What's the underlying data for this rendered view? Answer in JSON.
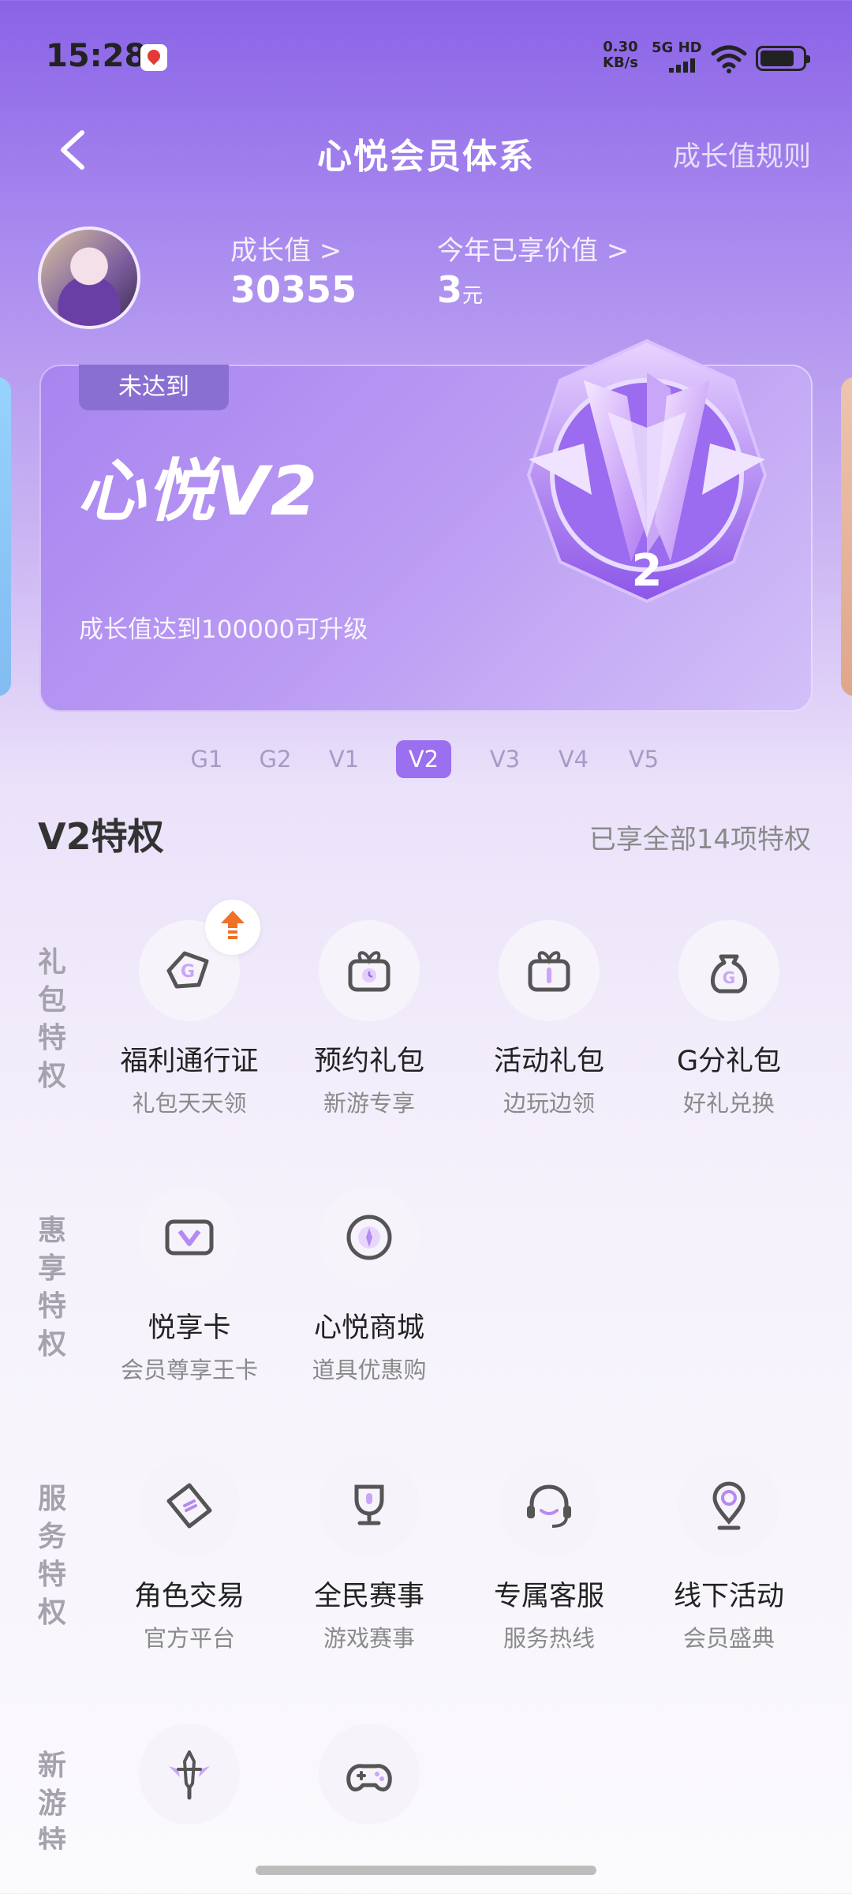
{
  "status": {
    "time": "15:28",
    "net_speed_value": "0.30",
    "net_speed_unit": "KB/s",
    "network": "5G HD"
  },
  "nav": {
    "title": "心悦会员体系",
    "rules_link": "成长值规则"
  },
  "profile": {
    "growth_label": "成长值 >",
    "growth_value": "30355",
    "enjoy_label": "今年已享价值 >",
    "enjoy_value": "3",
    "enjoy_unit": "元"
  },
  "level_card": {
    "status": "未达到",
    "level_name": "心悦V2",
    "upgrade_tip": "成长值达到100000可升级",
    "medal_number": "2"
  },
  "levels": {
    "tabs": [
      "G1",
      "G2",
      "V1",
      "V2",
      "V3",
      "V4",
      "V5"
    ],
    "active": "V2"
  },
  "privileges": {
    "title": "V2特权",
    "count_text": "已享全部14项特权"
  },
  "sections": [
    {
      "label": "礼包特权",
      "items": [
        {
          "name": "福利通行证",
          "sub": "礼包天天领",
          "icon": "gift-tag-icon"
        },
        {
          "name": "预约礼包",
          "sub": "新游专享",
          "icon": "reserve-gift-icon"
        },
        {
          "name": "活动礼包",
          "sub": "边玩边领",
          "icon": "gift-box-icon"
        },
        {
          "name": "G分礼包",
          "sub": "好礼兑换",
          "icon": "money-bag-icon"
        }
      ]
    },
    {
      "label": "惠享特权",
      "items": [
        {
          "name": "悦享卡",
          "sub": "会员尊享王卡",
          "icon": "vip-card-icon"
        },
        {
          "name": "心悦商城",
          "sub": "道具优惠购",
          "icon": "shop-disc-icon"
        }
      ]
    },
    {
      "label": "服务特权",
      "items": [
        {
          "name": "角色交易",
          "sub": "官方平台",
          "icon": "ticket-icon"
        },
        {
          "name": "全民赛事",
          "sub": "游戏赛事",
          "icon": "trophy-icon"
        },
        {
          "name": "专属客服",
          "sub": "服务热线",
          "icon": "headset-icon"
        },
        {
          "name": "线下活动",
          "sub": "会员盛典",
          "icon": "location-pin-icon"
        }
      ]
    },
    {
      "label": "新游特",
      "items": [
        {
          "name": "",
          "sub": "",
          "icon": "sword-icon"
        },
        {
          "name": "",
          "sub": "",
          "icon": "gamepad-icon"
        }
      ]
    }
  ]
}
